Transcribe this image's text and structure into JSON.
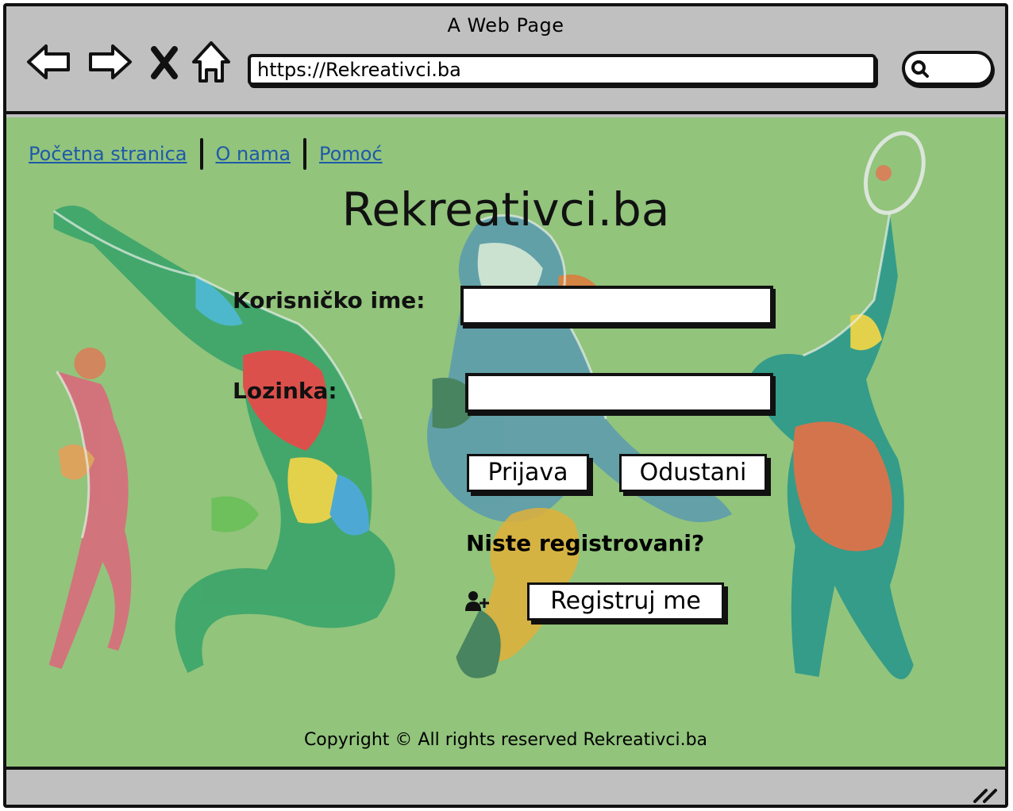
{
  "browser": {
    "window_title": "A Web Page",
    "url": "https://Rekreativci.ba",
    "search_placeholder": ""
  },
  "nav": {
    "items": [
      {
        "label": "Početna stranica"
      },
      {
        "label": "O nama"
      },
      {
        "label": "Pomoć"
      }
    ]
  },
  "site_title": "Rekreativci.ba",
  "login": {
    "username_label": "Korisničko ime:",
    "username_value": "",
    "password_label": "Lozinka:",
    "password_value": "",
    "login_button": "Prijava",
    "cancel_button": "Odustani"
  },
  "register": {
    "question": "Niste registrovani?",
    "button": "Registruj me",
    "icon": "user-plus-icon"
  },
  "footer": {
    "copyright": "Copyright © All rights reserved Rekreativci.ba"
  },
  "colors": {
    "page_background": "#92c47c",
    "browser_chrome": "#c0c0c0",
    "link": "#1f5aa8"
  }
}
